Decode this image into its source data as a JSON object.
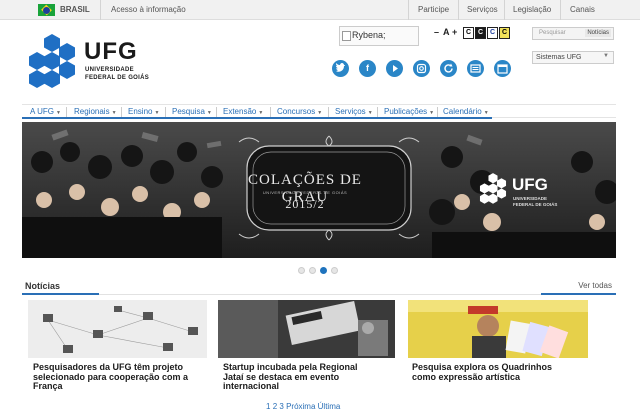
{
  "govbar": {
    "country": "BRASIL",
    "access_info": "Acesso à informação",
    "links": [
      "Participe",
      "Serviços",
      "Legislação",
      "Canais"
    ]
  },
  "header": {
    "logo_text": "UFG",
    "logo_sub1": "UNIVERSIDADE",
    "logo_sub2": "FEDERAL DE GOIÁS",
    "rybena_alt": "Rybena;",
    "accessibility": {
      "minus": "–",
      "a": "A",
      "plus": "+",
      "contrast": [
        "C",
        "C",
        "C",
        "C"
      ]
    },
    "search_placeholder": "Pesquisar",
    "search_option": "Notícias",
    "systems_label": "Sistemas UFG",
    "social_icons": [
      "twitter-icon",
      "facebook-icon",
      "youtube-icon",
      "instagram-icon",
      "refresh-icon",
      "news-icon",
      "calendar-icon"
    ]
  },
  "nav": {
    "items": [
      "A UFG",
      "Regionais",
      "Ensino",
      "Pesquisa",
      "Extensão",
      "Concursos",
      "Serviços",
      "Publicações",
      "Calendário"
    ]
  },
  "banner": {
    "title": "COLAÇÕES DE GRAU",
    "subtitle": "UNIVERSIDADE FEDERAL DE GOIÁS",
    "period": "2015/2",
    "logo_text": "UFG",
    "logo_sub1": "UNIVERSIDADE",
    "logo_sub2": "FEDERAL DE GOIÁS",
    "slides_count": 4,
    "active_slide": 3
  },
  "news": {
    "heading": "Notícias",
    "see_all": "Ver todas",
    "cards": [
      {
        "title_l1": "Pesquisadores da UFG têm projeto",
        "title_l2": "selecionado para cooperação com a",
        "title_l3": "França"
      },
      {
        "title_l1": "Startup incubada pela Regional",
        "title_l2": "Jataí se destaca em evento",
        "title_l3": "internacional"
      },
      {
        "title_l1": "Pesquisa explora os Quadrinhos",
        "title_l2": "como expressão artística",
        "title_l3": ""
      }
    ],
    "pager": {
      "p1": "1",
      "p2": "2",
      "p3": "3",
      "next": "Próxima",
      "last": "Última"
    }
  },
  "colors": {
    "accent": "#2a6fb6",
    "logo_blue": "#1f6fc4",
    "social_blue": "#2a86c7"
  }
}
